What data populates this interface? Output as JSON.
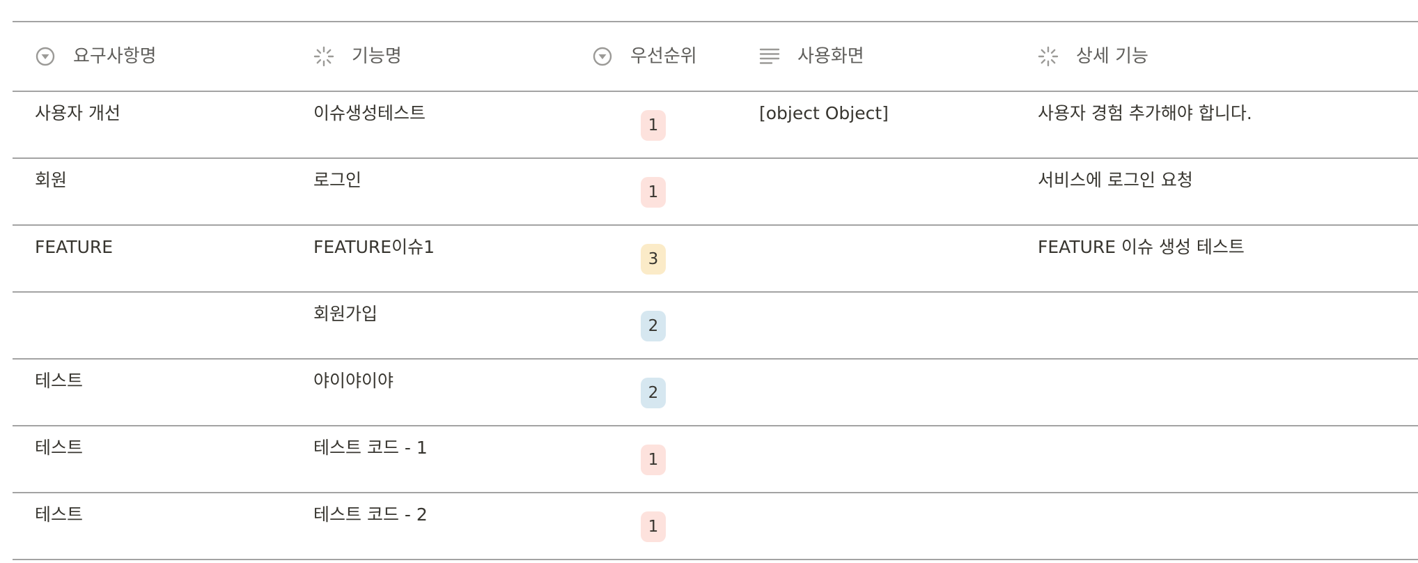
{
  "headers": {
    "requirement": "요구사항명",
    "feature": "기능명",
    "priority": "우선순위",
    "screen": "사용화면",
    "detail": "상세 기능"
  },
  "priority_colors": {
    "1": "#fde2dd",
    "2": "#d6e7f0",
    "3": "#fbebc8"
  },
  "rows": [
    {
      "requirement": "사용자 개선",
      "feature": "이슈생성테스트",
      "priority": "1",
      "screen": "[object Object]",
      "detail": "사용자 경험 추가해야 합니다."
    },
    {
      "requirement": "회원",
      "feature": "로그인",
      "priority": "1",
      "screen": "",
      "detail": "서비스에 로그인 요청"
    },
    {
      "requirement": "FEATURE",
      "feature": "FEATURE이슈1",
      "priority": "3",
      "screen": "",
      "detail": "FEATURE 이슈 생성 테스트"
    },
    {
      "requirement": "",
      "feature": "회원가입",
      "priority": "2",
      "screen": "",
      "detail": ""
    },
    {
      "requirement": "테스트",
      "feature": "야이야이야",
      "priority": "2",
      "screen": "",
      "detail": ""
    },
    {
      "requirement": "테스트",
      "feature": "테스트 코드 - 1",
      "priority": "1",
      "screen": "",
      "detail": ""
    },
    {
      "requirement": "테스트",
      "feature": "테스트 코드 - 2",
      "priority": "1",
      "screen": "",
      "detail": ""
    }
  ]
}
